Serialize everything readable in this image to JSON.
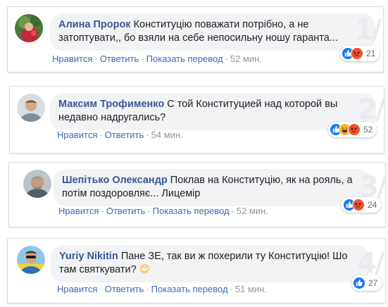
{
  "comments": [
    {
      "author": "Алина Пророк",
      "text": "Конституцію поважати потрібно, а не затоптувати,, бо взяли на себе непосильну ношу гаранта...",
      "actions": [
        "Нравится",
        "Ответить",
        "Показать перевод"
      ],
      "time": "52 мин.",
      "reactions": [
        "like-icon",
        "angry-icon"
      ],
      "reaction_count": "21",
      "watermark": "1/"
    },
    {
      "author": "Максим Трофименко",
      "text": "С той Конституцией над которой вы недавно надругались?",
      "actions": [
        "Нравится",
        "Ответить"
      ],
      "time": "54 мин.",
      "reactions": [
        "like-icon",
        "haha-icon",
        "angry-icon"
      ],
      "reaction_count": "52",
      "watermark": "2/"
    },
    {
      "author": "Шепітько Олександр",
      "text": "Поклав на Конституцію, як на рояль, а потім поздоровляє... Лицемір",
      "actions": [
        "Нравится",
        "Ответить",
        "Показать перевод"
      ],
      "time": "52 мин.",
      "reactions": [
        "like-icon",
        "angry-icon"
      ],
      "reaction_count": "24",
      "watermark": "3/"
    },
    {
      "author": "Yuriy Nikitin",
      "text": "Пане ЗЕ, так ви ж похерили ту Конституцію! Шо там святкувати?",
      "emoji": "😊",
      "actions": [
        "Нравится",
        "Ответить",
        "Показать перевод"
      ],
      "time": "51 мин.",
      "reactions": [
        "like-icon"
      ],
      "reaction_count": "27",
      "watermark": "4/"
    }
  ],
  "colors": {
    "author": "#385898",
    "action_link": "#4267b2",
    "meta": "#90949c",
    "bubble": "#f2f3f5",
    "like": "#1877f2",
    "angry": "#f0522e",
    "haha": "#f7b125"
  }
}
